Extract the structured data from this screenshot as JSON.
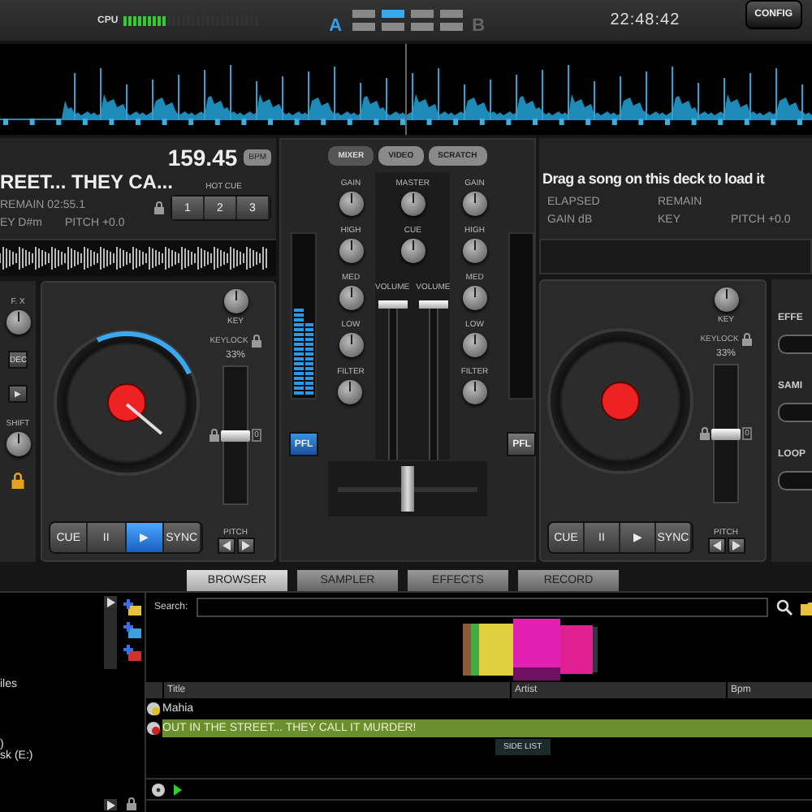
{
  "top_bar": {
    "cpu": {
      "label": "CPU",
      "level": 0.32
    },
    "deck_a": "A",
    "layouts": [
      {
        "selected": false
      },
      {
        "selected": true
      },
      {
        "selected": false
      },
      {
        "selected": false
      },
      {
        "selected": false
      },
      {
        "selected": false
      },
      {
        "selected": false
      },
      {
        "selected": false
      }
    ],
    "deck_b": "B",
    "clock": "22:48:42",
    "config": "CONFIG"
  },
  "left_deck": {
    "title": "REET... THEY CA...",
    "bpm": "159.45",
    "bpm_unit": "BPM",
    "hot_cue_label": "HOT CUE",
    "hot_cues": [
      "1",
      "2",
      "3"
    ],
    "info_rows": [
      [
        "REMAIN 02:55.1"
      ],
      [
        "EY D#m",
        "PITCH +0.0"
      ]
    ],
    "loaded": true,
    "key_label": "KEY",
    "keylock_label": "KEYLOCK",
    "pitch_range": "33%",
    "pitch_zero": "0",
    "pitch_slider": {
      "level": 0.5
    },
    "pitch_label": "PITCH",
    "transport": [
      {
        "label": "CUE",
        "active": false
      },
      {
        "label": "II",
        "active": false
      },
      {
        "label": "▶",
        "active": true
      },
      {
        "label": "SYNC",
        "active": false
      }
    ]
  },
  "left_strip": [
    {
      "kind": "knob",
      "label": "F. X"
    },
    {
      "kind": "button",
      "label": "DEC"
    },
    {
      "kind": "button",
      "label": "▶"
    },
    {
      "kind": "knob",
      "label": "SHIFT"
    },
    {
      "kind": "lock"
    }
  ],
  "mixer": {
    "tabs": [
      {
        "label": "MIXER",
        "selected": true
      },
      {
        "label": "VIDEO",
        "selected": false
      },
      {
        "label": "SCRATCH",
        "selected": false
      }
    ],
    "left_channel": {
      "knobs": [
        "GAIN",
        "HIGH",
        "MED",
        "LOW",
        "FILTER"
      ],
      "vu": [
        {
          "level": 0.55
        },
        {
          "level": 0.45
        }
      ],
      "pfl": {
        "label": "PFL",
        "on": true
      }
    },
    "center": {
      "knobs": [
        "MASTER",
        "CUE"
      ],
      "faders": [
        {
          "label": "VOLUME",
          "level": 1
        },
        {
          "label": "VOLUME",
          "level": 1
        }
      ]
    },
    "right_channel": {
      "knobs": [
        "GAIN",
        "HIGH",
        "MED",
        "LOW",
        "FILTER"
      ],
      "pfl": {
        "label": "PFL",
        "on": false
      }
    },
    "crossfader": {
      "level": 0.5
    }
  },
  "right_deck": {
    "title": "Drag a song on this deck to load it",
    "info_rows": [
      [
        "ELAPSED",
        "REMAIN"
      ],
      [
        "GAIN dB",
        "KEY",
        "PITCH +0.0"
      ]
    ],
    "loaded": false,
    "key_label": "KEY",
    "keylock_label": "KEYLOCK",
    "pitch_range": "33%",
    "pitch_zero": "0",
    "pitch_slider": {
      "level": 0.5
    },
    "pitch_label": "PITCH",
    "transport": [
      {
        "label": "CUE",
        "active": false
      },
      {
        "label": "II",
        "active": false
      },
      {
        "label": "▶",
        "active": false
      },
      {
        "label": "SYNC",
        "active": false
      }
    ]
  },
  "right_strip": [
    {
      "label": "EFFE"
    },
    {
      "label": "SAMI"
    },
    {
      "label": "LOOP"
    }
  ],
  "bottom_tabs": [
    {
      "label": "BROWSER",
      "selected": true
    },
    {
      "label": "SAMPLER",
      "selected": false
    },
    {
      "label": "EFFECTS",
      "selected": false
    },
    {
      "label": "RECORD",
      "selected": false
    }
  ],
  "browser": {
    "tree": [
      "iles",
      ")",
      "sk (E:)"
    ],
    "search_label": "Search:",
    "columns": [
      "Title",
      "Artist",
      "Bpm"
    ],
    "rows": [
      {
        "title": "Mahia",
        "color": "#e0c020",
        "selected": false
      },
      {
        "title": "OUT IN THE STREET... THEY CALL IT MURDER!",
        "color": "#d02020",
        "selected": true
      }
    ],
    "side_list": "SIDE LIST"
  }
}
